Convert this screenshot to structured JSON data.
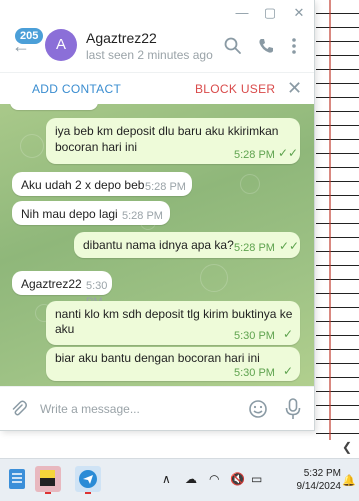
{
  "window": {
    "controls": [
      "minimize",
      "maximize",
      "close"
    ]
  },
  "header": {
    "unread_badge": "205",
    "avatar_letter": "A",
    "contact_name": "Agaztrez22",
    "last_seen": "last seen 2 minutes ago",
    "avatar_color": "#8b6fd8"
  },
  "actions": {
    "add_contact": "ADD CONTACT",
    "block_user": "BLOCK USER"
  },
  "messages": [
    {
      "dir": "out",
      "text_line1": "iya beb km deposit dlu baru aku kkirimkan",
      "text_line2": "bocoran hari ini",
      "time": "5:28 PM",
      "status": "read"
    },
    {
      "dir": "in",
      "text": "Aku udah 2 x depo beb",
      "time": "5:28 PM"
    },
    {
      "dir": "in",
      "text": "Nih mau depo lagi",
      "time": "5:28 PM"
    },
    {
      "dir": "out",
      "text": "dibantu nama idnya apa ka?",
      "time": "5:28 PM",
      "status": "read"
    },
    {
      "dir": "in",
      "text": "Agaztrez22",
      "time": "5:30 PM"
    },
    {
      "dir": "out",
      "text_line1": "nanti klo km sdh deposit tlg kirim buktinya ke",
      "text_line2": "aku",
      "time": "5:30 PM",
      "status": "sent"
    },
    {
      "dir": "out",
      "text": "biar aku bantu dengan bocoran hari ini",
      "time": "5:30 PM",
      "status": "sent"
    }
  ],
  "composer": {
    "placeholder": "Write a message..."
  },
  "taskbar": {
    "time": "5:32 PM",
    "date": "9/14/2024"
  },
  "colors": {
    "accent_blue": "#3a8dd0",
    "block_red": "#d94a4a",
    "outgoing_bubble": "#eefbd9",
    "read_check": "#5fa34f"
  }
}
